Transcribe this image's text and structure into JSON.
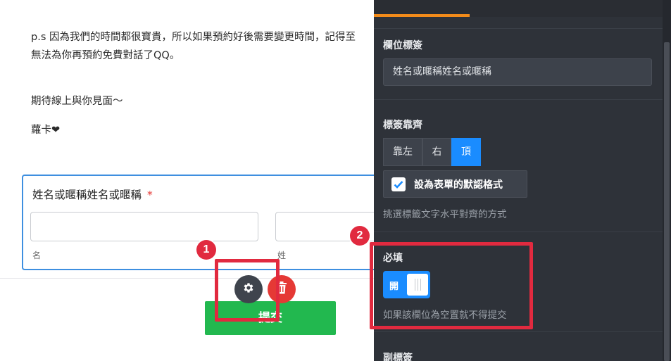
{
  "content": {
    "paragraph_line_1": "p.s 因為我們的時間都很寶貴，所以如果預約好後需要變更時間，記得至",
    "paragraph_line_2": "無法為你再預約免費對話了QQ。",
    "paragraph_3": "期待線上與你見面～",
    "signature": "蘿卡❤"
  },
  "form": {
    "field_label": "姓名或暱稱姓名或暱稱",
    "required_mark": "*",
    "first_name_sublabel": "名",
    "last_name_sublabel": "姓",
    "submit_label": "提交",
    "gear_icon": "gear-icon",
    "trash_icon": "trash-icon"
  },
  "callouts": {
    "badge_1": "1",
    "badge_2": "2",
    "color": "#e12a3f"
  },
  "panel": {
    "label_section_title": "欄位標簽",
    "label_value": "姓名或暱稱姓名或暱稱",
    "alignment_title": "標簽靠齊",
    "alignment_options": [
      "靠左",
      "右",
      "頂"
    ],
    "alignment_selected": "頂",
    "default_format_label": "設為表單的默認格式",
    "alignment_hint": "挑選標籤文字水平對齊的方式",
    "required_title": "必填",
    "required_toggle_label": "開",
    "required_hint": "如果該欄位為空置就不得提交",
    "sublabel_section_title": "副標簽",
    "accent_color": "#1a8cff",
    "tab_accent_color": "#f28b1a"
  }
}
